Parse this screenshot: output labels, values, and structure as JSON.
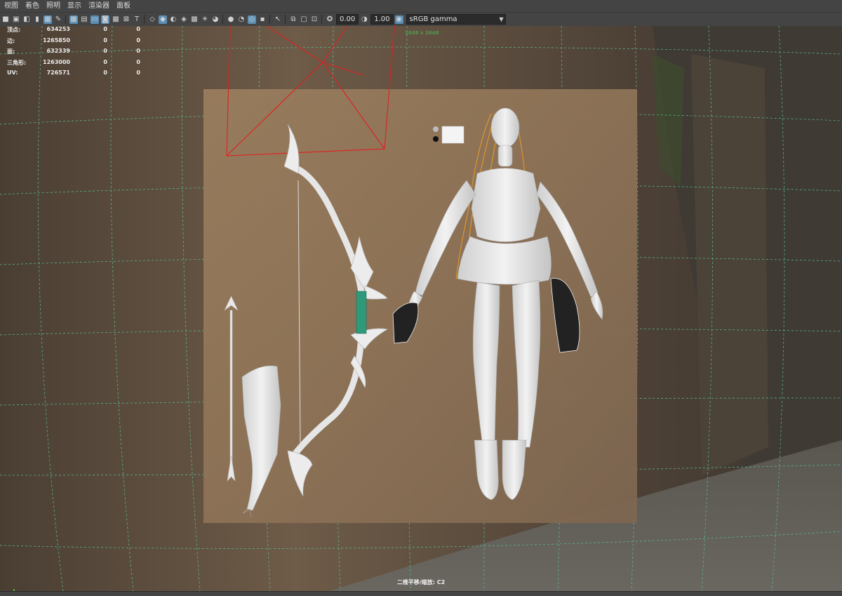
{
  "menu": [
    "视图",
    "着色",
    "照明",
    "显示",
    "渲染器",
    "面板"
  ],
  "toolbar": {
    "exposure_value": "0.00",
    "gamma_value": "1.00",
    "color_space": "sRGB gamma"
  },
  "hud_stats": {
    "rows": [
      {
        "label": "顶点:",
        "v1": "634253",
        "v2": "0",
        "v3": "0"
      },
      {
        "label": "边:",
        "v1": "1265850",
        "v2": "0",
        "v3": "0"
      },
      {
        "label": "面:",
        "v1": "632339",
        "v2": "0",
        "v3": "0"
      },
      {
        "label": "三角形:",
        "v1": "1263000",
        "v2": "0",
        "v3": "0"
      },
      {
        "label": "UV:",
        "v1": "726571",
        "v2": "0",
        "v3": "0"
      }
    ]
  },
  "resolution_label": "2048 x 2048",
  "bottom_hud": "二维平移/缩放: C2",
  "icons": {
    "toolbar": [
      "camera-icon",
      "camera-attr-icon",
      "bookmark-icon",
      "image-plane-icon",
      "grid-icon",
      "film-gate-icon",
      "resolution-gate-icon",
      "gate-mask-icon",
      "field-chart-icon",
      "safe-action-icon",
      "safe-title-icon",
      "wireframe-icon",
      "smooth-shade-icon",
      "default-material-icon",
      "xray-icon",
      "wireframe-on-shaded-icon",
      "lights-icon",
      "shadows-icon",
      "ambient-occlusion-icon",
      "motion-blur-icon",
      "antialias-icon",
      "isolate-icon",
      "select-icon",
      "pan-zoom-icon",
      "exposure-icon",
      "gamma-icon",
      "color-management-icon",
      "chevron-down-icon"
    ]
  },
  "colors": {
    "ui_bg": "#444444",
    "selected_icon": "#5c8fb5",
    "grid": "#57c89a",
    "camera_frustum": "#e02020",
    "hair": "#e59a2a",
    "bow_accent": "#2e9a7a"
  }
}
